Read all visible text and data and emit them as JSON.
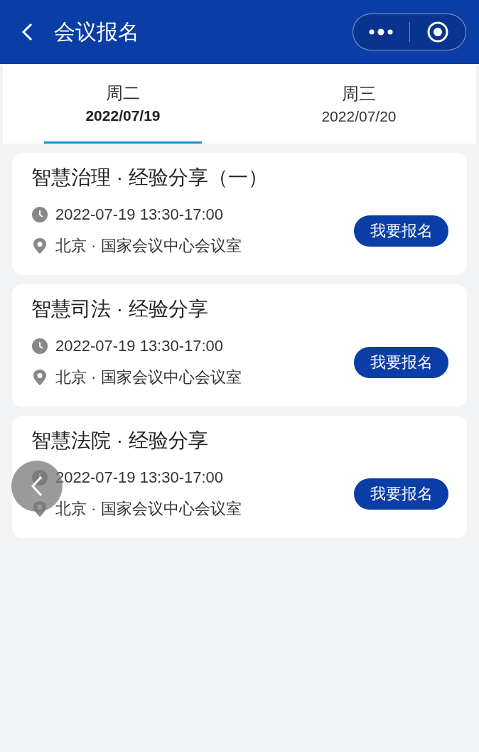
{
  "header": {
    "title": "会议报名"
  },
  "tabs": [
    {
      "day": "周二",
      "date": "2022/07/19",
      "selected": true
    },
    {
      "day": "周三",
      "date": "2022/07/20",
      "selected": false
    }
  ],
  "meetings": [
    {
      "title": "智慧治理 · 经验分享（一）",
      "time": "2022-07-19 13:30-17:00",
      "place": "北京 · 国家会议中心会议室",
      "button": "我要报名"
    },
    {
      "title": "智慧司法 · 经验分享",
      "time": "2022-07-19 13:30-17:00",
      "place": "北京 · 国家会议中心会议室",
      "button": "我要报名"
    },
    {
      "title": "智慧法院 · 经验分享",
      "time": "2022-07-19 13:30-17:00",
      "place": "北京 · 国家会议中心会议室",
      "button": "我要报名"
    }
  ]
}
